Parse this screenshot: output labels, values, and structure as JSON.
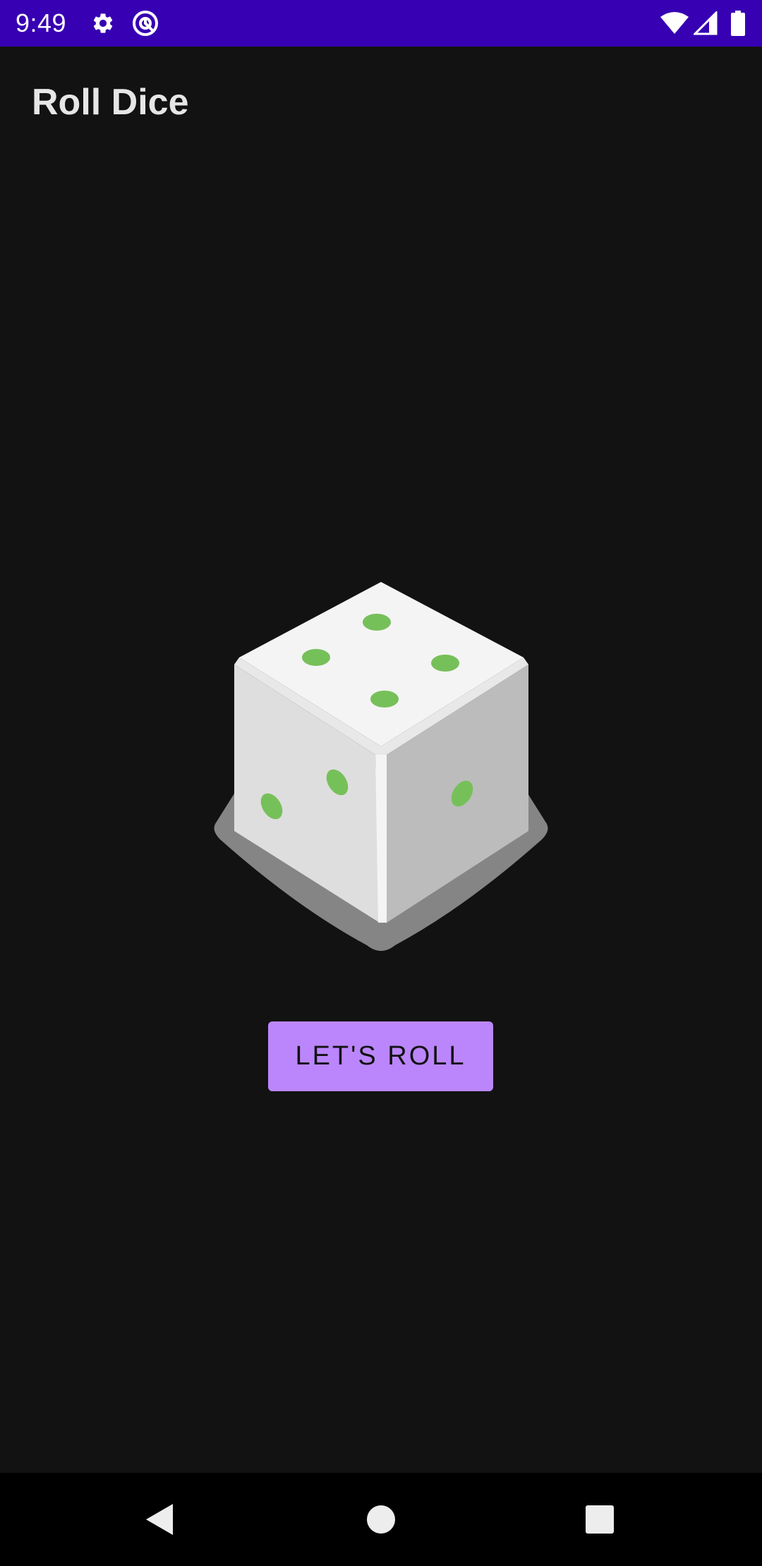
{
  "status_bar": {
    "time": "9:49",
    "background": "#3700b3",
    "left_icons": [
      "settings-gear-icon",
      "at-sign-notification-icon"
    ],
    "right_icons": [
      "wifi-icon",
      "cellular-signal-icon",
      "battery-icon"
    ]
  },
  "app": {
    "title": "Roll Dice"
  },
  "dice": {
    "top_face_pips": 4,
    "left_face_pips": 2,
    "right_face_pips": 1,
    "pip_color": "#76c05a"
  },
  "button": {
    "label": "LET'S ROLL",
    "color": "#bb86fc"
  },
  "nav_bar": {
    "items": [
      "back-icon",
      "home-icon",
      "recents-icon"
    ]
  }
}
